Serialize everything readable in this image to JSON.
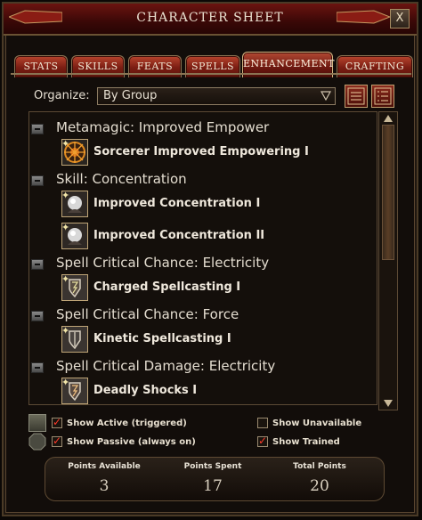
{
  "window": {
    "title": "CHARACTER SHEET",
    "close_label": "X"
  },
  "tabs": [
    {
      "label": "STATS"
    },
    {
      "label": "SKILLS"
    },
    {
      "label": "FEATS"
    },
    {
      "label": "SPELLS"
    },
    {
      "label": "ENHANCEMENT",
      "active": true
    },
    {
      "label": "CRAFTING"
    }
  ],
  "organize": {
    "label": "Organize:",
    "value": "By Group"
  },
  "groups": [
    {
      "title": "Metamagic: Improved Empower",
      "entries": [
        {
          "label": "Sorcerer Improved Empowering I",
          "icon": "sunburst-icon"
        }
      ]
    },
    {
      "title": "Skill: Concentration",
      "entries": [
        {
          "label": "Improved Concentration I",
          "icon": "orb-icon"
        },
        {
          "label": "Improved Concentration II",
          "icon": "orb-icon"
        }
      ]
    },
    {
      "title": "Spell Critical Chance: Electricity",
      "entries": [
        {
          "label": "Charged Spellcasting I",
          "icon": "shield-icon"
        }
      ]
    },
    {
      "title": "Spell Critical Chance: Force",
      "entries": [
        {
          "label": "Kinetic Spellcasting I",
          "icon": "shield-icon"
        }
      ]
    },
    {
      "title": "Spell Critical Damage: Electricity",
      "entries": [
        {
          "label": "Deadly Shocks I",
          "icon": "shield-icon"
        }
      ]
    }
  ],
  "filters": {
    "show_active": {
      "label": "Show Active (triggered)",
      "checked": true
    },
    "show_passive": {
      "label": "Show Passive (always on)",
      "checked": true
    },
    "show_unavailable": {
      "label": "Show Unavailable",
      "checked": false
    },
    "show_trained": {
      "label": "Show Trained",
      "checked": true
    }
  },
  "points": {
    "available_label": "Points Available",
    "available": "3",
    "spent_label": "Points Spent",
    "spent": "17",
    "total_label": "Total Points",
    "total": "20"
  }
}
